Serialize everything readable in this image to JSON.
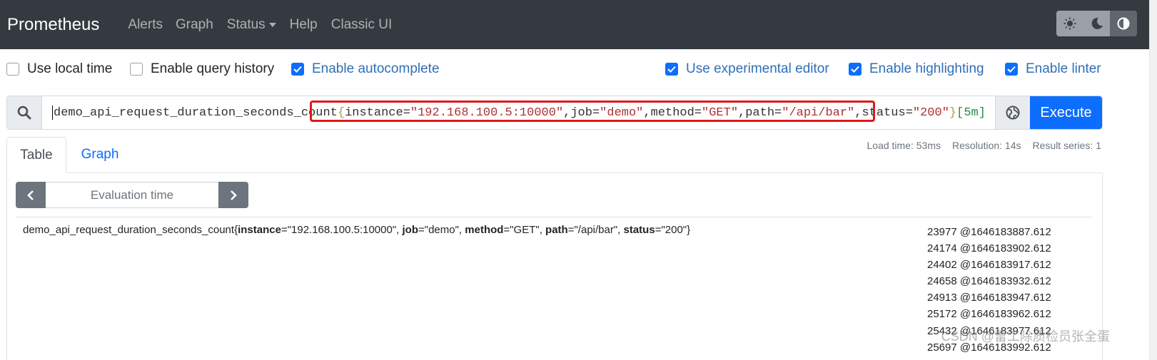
{
  "nav": {
    "brand": "Prometheus",
    "links": [
      "Alerts",
      "Graph",
      "Status",
      "Help",
      "Classic UI"
    ]
  },
  "options": {
    "local_time": "Use local time",
    "query_history": "Enable query history",
    "autocomplete": "Enable autocomplete",
    "experimental_editor": "Use experimental editor",
    "highlighting": "Enable highlighting",
    "linter": "Enable linter"
  },
  "query": {
    "metric": "demo_api_request_duration_seconds_count",
    "open_brace": "{",
    "label1": "instance=",
    "value1": "\"192.168.100.5:10000\"",
    "sep1": ", ",
    "label2": "job=",
    "value2": "\"demo\"",
    "sep2": ", ",
    "label3": "method=",
    "value3": "\"GET\"",
    "sep3": ", ",
    "label4": "path=",
    "value4": "\"/api/bar\"",
    "sep4": ", ",
    "label5": "status=",
    "value5": "\"200\"",
    "close_brace": "}",
    "range": "[5m]",
    "execute_label": "Execute"
  },
  "tabs": {
    "table": "Table",
    "graph": "Graph"
  },
  "stats": {
    "load_time": "Load time: 53ms",
    "resolution": "Resolution: 14s",
    "result_series": "Result series: 1"
  },
  "eval_time_placeholder": "Evaluation time",
  "result": {
    "metric": "demo_api_request_duration_seconds_count",
    "open": "{",
    "k1": "instance",
    "v1": "=\"192.168.100.5:10000\", ",
    "k2": "job",
    "v2": "=\"demo\", ",
    "k3": "method",
    "v3": "=\"GET\", ",
    "k4": "path",
    "v4": "=\"/api/bar\", ",
    "k5": "status",
    "v5": "=\"200\"",
    "close": "}",
    "values": [
      "23977 @1646183887.612",
      "24174 @1646183902.612",
      "24402 @1646183917.612",
      "24658 @1646183932.612",
      "24913 @1646183947.612",
      "25172 @1646183962.612",
      "25432 @1646183977.612",
      "25697 @1646183992.612"
    ]
  },
  "watermark": "CSDN @雷工除质检员张全蛋"
}
